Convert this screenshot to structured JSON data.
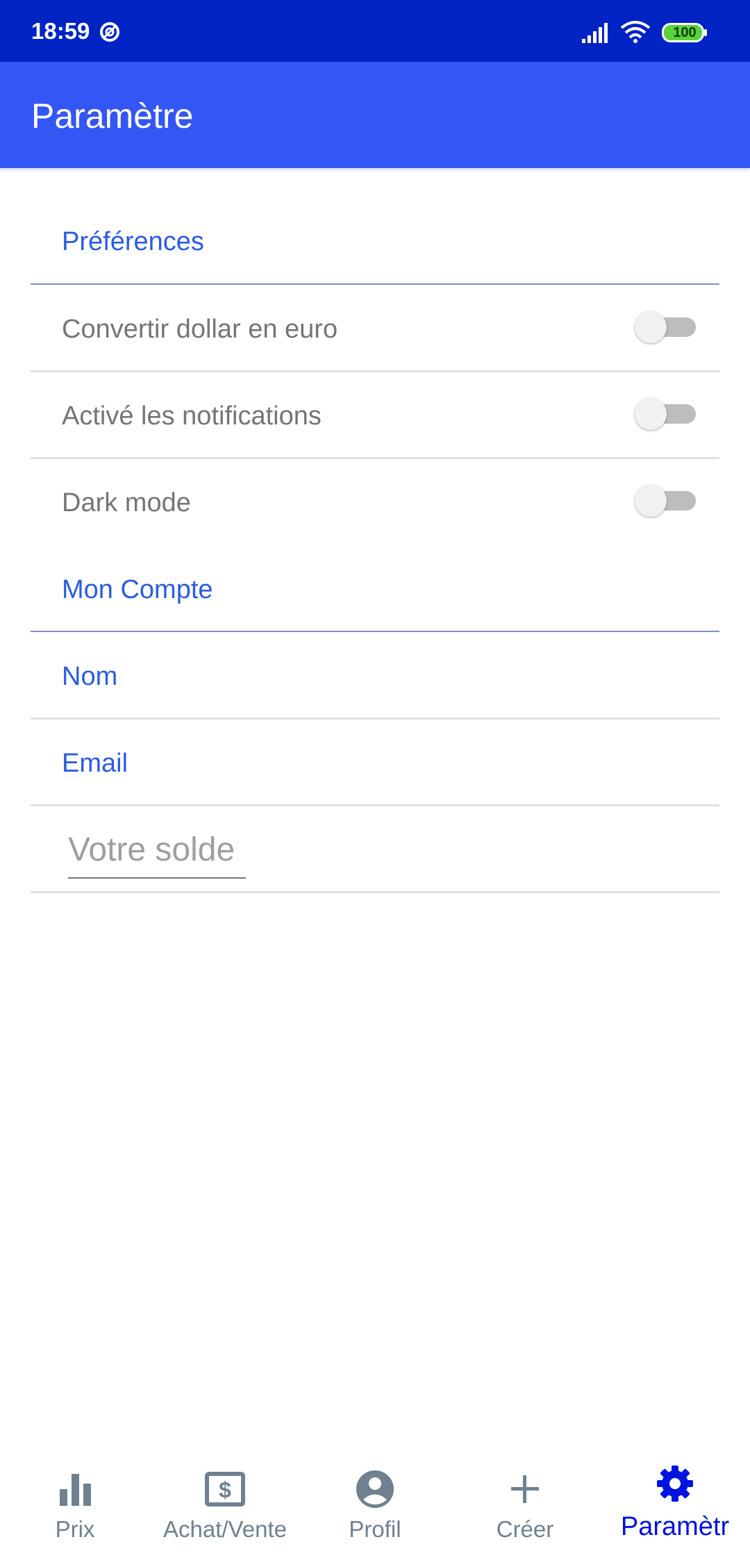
{
  "status_bar": {
    "time": "18:59",
    "battery": "100"
  },
  "app_bar": {
    "title": "Paramètre"
  },
  "preferences": {
    "header": "Préférences",
    "items": [
      {
        "label": "Convertir dollar en euro",
        "enabled": false
      },
      {
        "label": "Activé les notifications",
        "enabled": false
      },
      {
        "label": "Dark mode",
        "enabled": false
      }
    ]
  },
  "account": {
    "header": "Mon Compte",
    "name_label": "Nom",
    "email_label": "Email",
    "balance_placeholder": "Votre solde"
  },
  "bottom_nav": {
    "items": [
      {
        "label": "Prix",
        "icon": "bar-chart-icon",
        "active": false
      },
      {
        "label": "Achat/Vente",
        "icon": "dollar-bill-icon",
        "active": false
      },
      {
        "label": "Profil",
        "icon": "account-circle-icon",
        "active": false
      },
      {
        "label": "Créer",
        "icon": "plus-icon",
        "active": false
      },
      {
        "label": "Paramètr",
        "icon": "gear-icon",
        "active": true
      }
    ]
  },
  "colors": {
    "status_bar": "#0024c4",
    "app_bar": "#3456f5",
    "accent_text": "#2b5ce0",
    "nav_active": "#0014e0",
    "nav_inactive": "#6f8190"
  }
}
